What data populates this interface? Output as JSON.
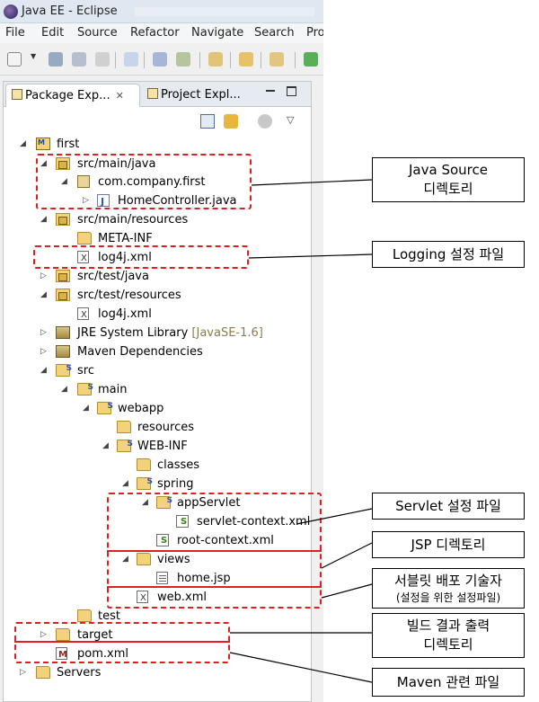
{
  "window": {
    "title": "Java EE - Eclipse"
  },
  "menu": [
    "File",
    "Edit",
    "Source",
    "Refactor",
    "Navigate",
    "Search",
    "Pro"
  ],
  "tabs": {
    "active": "Package Exp...",
    "inactive": "Project Expl..."
  },
  "tree": {
    "project": "first",
    "src_main_java": "src/main/java",
    "pkg": "com.company.first",
    "home_controller": "HomeController.java",
    "src_main_resources": "src/main/resources",
    "meta_inf": "META-INF",
    "log4j_main": "log4j.xml",
    "src_test_java": "src/test/java",
    "src_test_resources": "src/test/resources",
    "log4j_test": "log4j.xml",
    "jre_lib": "JRE System Library",
    "jre_version": "[JavaSE-1.6]",
    "maven_deps": "Maven Dependencies",
    "src": "src",
    "main": "main",
    "webapp": "webapp",
    "resources": "resources",
    "web_inf": "WEB-INF",
    "classes": "classes",
    "spring": "spring",
    "app_servlet": "appServlet",
    "servlet_context": "servlet-context.xml",
    "root_context": "root-context.xml",
    "views": "views",
    "home_jsp": "home.jsp",
    "web_xml": "web.xml",
    "test": "test",
    "target": "target",
    "pom": "pom.xml",
    "servers": "Servers"
  },
  "callouts": {
    "java_source_1": "Java Source",
    "java_source_2": "디렉토리",
    "logging": "Logging 설정 파일",
    "servlet": "Servlet 설정 파일",
    "jsp": "JSP 디렉토리",
    "descriptor_1": "서블릿 배포 기술자",
    "descriptor_2": "(설정을 위한 설정파일)",
    "build_1": "빌드 결과 출력",
    "build_2": "디렉토리",
    "maven": "Maven 관련 파일"
  },
  "colors": {
    "annotation": "#e02020",
    "callout_border": "#000000"
  }
}
